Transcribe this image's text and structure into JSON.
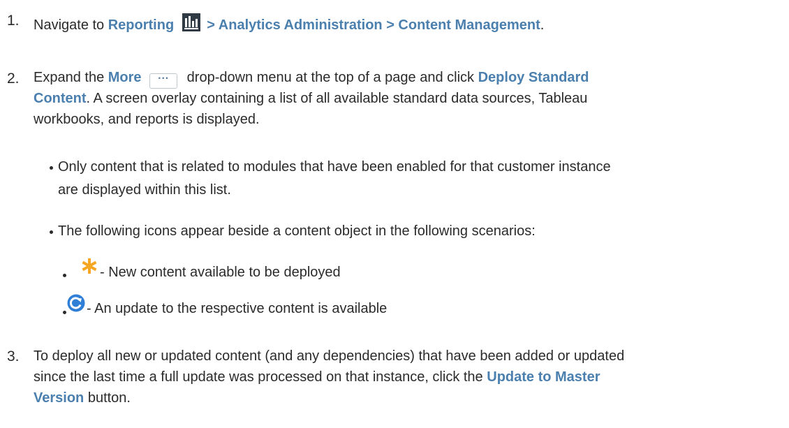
{
  "steps": [
    {
      "number": "1.",
      "parts": {
        "pre": "Navigate to ",
        "reporting": "Reporting",
        "path": " > Analytics Administration > Content Management",
        "end": "."
      }
    },
    {
      "number": "2.",
      "line1": {
        "pre": "Expand the ",
        "more": "More",
        "mid": " drop-down menu at the top of a page and click ",
        "deploy": "Deploy Standard"
      },
      "line2": {
        "content": "Content",
        "rest": ". A screen overlay containing a list of all available standard data sources, Tableau"
      },
      "line3": "workbooks, and reports is displayed."
    },
    {
      "number": "3.",
      "line1": "To deploy all new or updated content (and any dependencies) that have been added or updated",
      "line2": {
        "pre": "since the last time a full update was processed on that instance, click the ",
        "link": "Update to Master"
      },
      "line3": {
        "link": "Version",
        "post": " button."
      }
    }
  ],
  "bullets": [
    {
      "line1": "Only content that is related to modules that have been enabled for that customer instance",
      "line2": "are displayed within this list."
    },
    {
      "line1": "The following icons appear beside a content object in the following scenarios:"
    }
  ],
  "icon_items": [
    {
      "icon": "asterisk-icon",
      "text": " - New content available to be deployed"
    },
    {
      "icon": "refresh-icon",
      "text": " - An update to the respective content is available"
    }
  ],
  "icons": {
    "reporting": "bar-chart-icon",
    "more": "ellipsis-button-icon",
    "more_glyph": "···"
  },
  "colors": {
    "link": "#4a7fae",
    "asterisk": "#f5a623",
    "refresh": "#2f7fd6",
    "text": "#2b2b2b"
  }
}
